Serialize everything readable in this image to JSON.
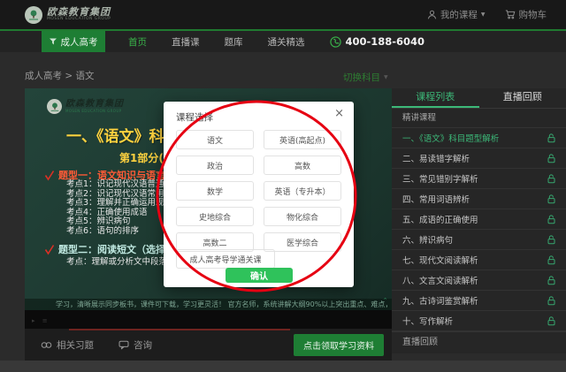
{
  "header": {
    "logo_cn": "欧森教育集团",
    "logo_en": "MOSEN EDUCATION GROUP",
    "my_courses": "我的课程",
    "cart": "购物车",
    "caret": "▼"
  },
  "nav": {
    "category": "成人高考",
    "links": [
      "首页",
      "直播课",
      "题库",
      "通关精选"
    ],
    "phone": "400-188-6040"
  },
  "breadcrumb": "成人高考 > 语文",
  "subject_switch": {
    "label": "切换科目",
    "caret": "▼"
  },
  "player": {
    "slide": {
      "logo_cn": "欧森教育集团",
      "logo_en": "MOSEN EDUCATION GROUP",
      "title": "一、《语文》科目题型解析",
      "part": "第1部分(选",
      "type1": "题型一：语文知识与语言运用（6",
      "type1_points": [
        "考点1：识记现代汉语普通话的",
        "考点2：识记现代汉语常用字的",
        "考点3：理解并正确运用现代汉",
        "考点4：正确使用成语",
        "考点5：辨识病句",
        "考点6：语句的排序"
      ],
      "type2": "题型二：阅读短文（选择）（4小",
      "type2_point": "考点：理解或分析文中段落大"
    },
    "marquee": "学习，清晰展示同步板书，课件可下载，学习更灵活！ 官方名师，系统讲解大纲90%以上突出重点、难点，紧跟命题方向透彻解析教材！海量全真",
    "collapse": "＾"
  },
  "modal": {
    "title": "课程选择",
    "close": "×",
    "subjects": [
      "语文",
      "英语(高起点)",
      "政治",
      "高数",
      "数学",
      "英语（专升本）",
      "史地综合",
      "物化综合",
      "高数二",
      "医学综合"
    ],
    "wide_subject": "成人高考导学通关课",
    "confirm": "确认"
  },
  "sidebar": {
    "tab_course_list": "课程列表",
    "tab_live_replay": "直播回顾",
    "section": "精讲课程",
    "lessons": [
      "一、《语文》科目题型解析",
      "二、易读错字解析",
      "三、常见错别字解析",
      "四、常用词语辨析",
      "五、成语的正确使用",
      "六、辨识病句",
      "七、现代文阅读解析",
      "八、文言文阅读解析",
      "九、古诗词鉴赏解析",
      "十、写作解析"
    ],
    "footer_tab": "直播回顾"
  },
  "actions": {
    "related": "相关习题",
    "consult": "咨询",
    "claim": "点击领取学习资料"
  },
  "colors": {
    "brand_green": "#1e7e34",
    "active_green": "#3cb878",
    "confirm_green": "#2fc25b",
    "annotation_red": "#e60012",
    "slide_yellow": "#ffd23f",
    "slide_red": "#ff5a36"
  }
}
